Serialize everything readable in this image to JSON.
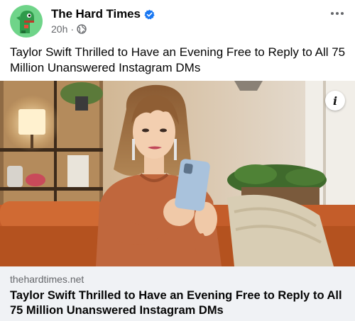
{
  "post": {
    "author": "The Hard Times",
    "time": "20h",
    "separator": "·",
    "audience_icon": "globe-icon",
    "verified_icon": "verified-badge-icon",
    "more_icon": "more-options-icon",
    "caption": "Taylor Swift Thrilled to Have an Evening Free to Reply to All 75 Million Unanswered Instagram DMs"
  },
  "image": {
    "info_icon": "info-icon",
    "info_label": "i"
  },
  "link_preview": {
    "domain": "thehardtimes.net",
    "title": "Taylor Swift Thrilled to Have an Evening Free to Reply to All 75 Million Unanswered Instagram DMs"
  },
  "colors": {
    "verified": "#1877f2",
    "secondary_text": "#65676b",
    "link_background": "#f0f2f5"
  }
}
